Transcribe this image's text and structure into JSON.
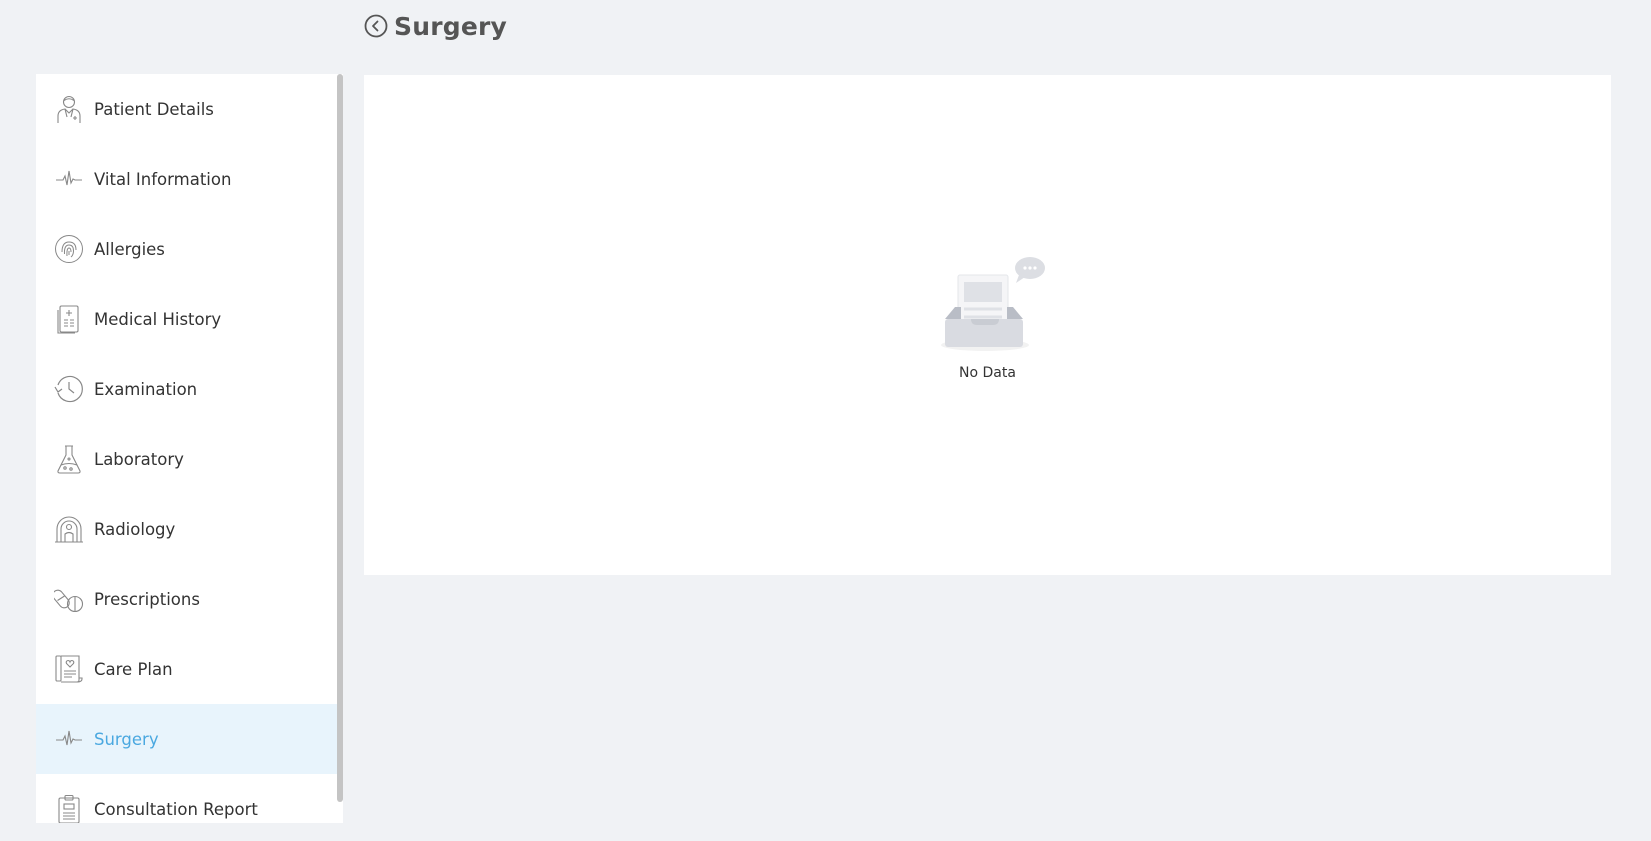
{
  "header": {
    "title": "Surgery",
    "back_icon": "back-circle-icon"
  },
  "sidebar": {
    "active_item": "Surgery",
    "items": [
      {
        "label": "Patient Details",
        "icon": "doctor-icon"
      },
      {
        "label": "Vital Information",
        "icon": "heartbeat-icon"
      },
      {
        "label": "Allergies",
        "icon": "fingerprint-icon"
      },
      {
        "label": "Medical History",
        "icon": "medical-record-icon"
      },
      {
        "label": "Examination",
        "icon": "history-clock-icon"
      },
      {
        "label": "Laboratory",
        "icon": "flask-icon"
      },
      {
        "label": "Radiology",
        "icon": "scanner-icon"
      },
      {
        "label": "Prescriptions",
        "icon": "pills-icon"
      },
      {
        "label": "Care Plan",
        "icon": "care-plan-icon"
      },
      {
        "label": "Surgery",
        "icon": "heartbeat-icon"
      },
      {
        "label": "Consultation Report",
        "icon": "clipboard-icon"
      }
    ]
  },
  "main": {
    "empty_text": "No Data",
    "empty_icon": "empty-inbox-icon"
  },
  "colors": {
    "background": "#f0f2f5",
    "active_bg": "#e8f4fc",
    "active_text": "#4aa8e0",
    "icon_stroke": "#888888"
  }
}
